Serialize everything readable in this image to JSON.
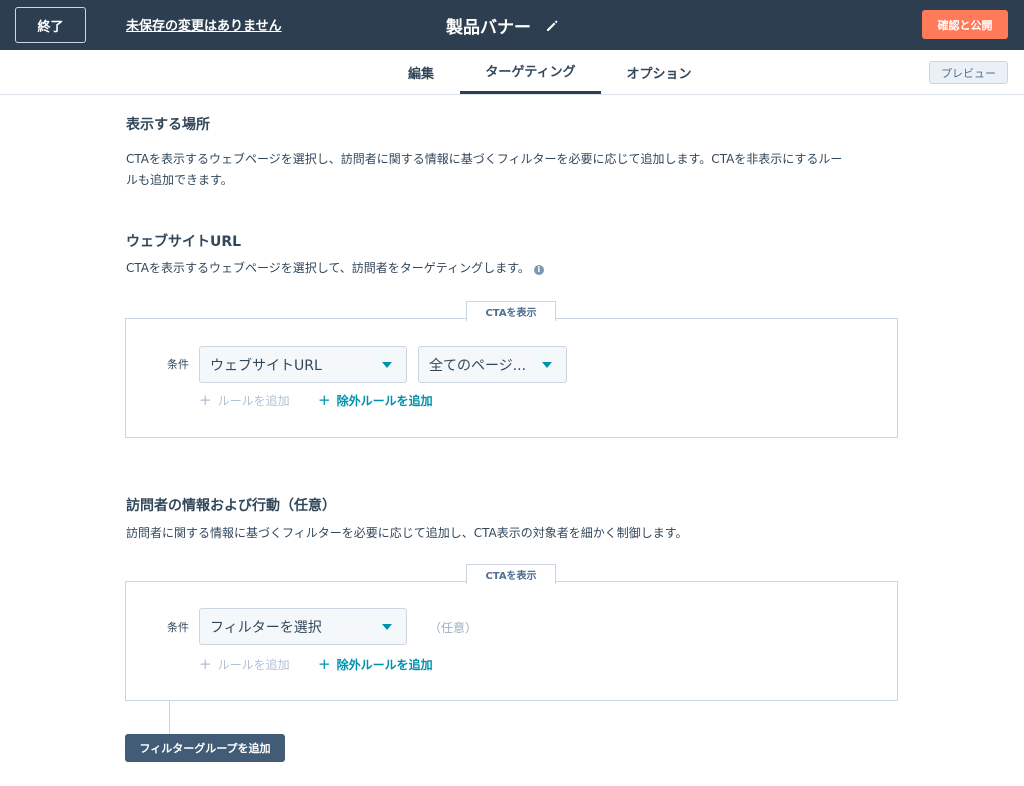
{
  "header": {
    "exit_label": "終了",
    "save_status": "未保存の変更はありません",
    "title": "製品バナー",
    "publish_label": "確認と公開"
  },
  "tabs": [
    {
      "label": "編集"
    },
    {
      "label": "ターゲティング",
      "active": true
    },
    {
      "label": "オプション"
    }
  ],
  "preview_label": "プレビュー",
  "where": {
    "heading": "表示する場所",
    "description_line1": "CTAを表示するウェブページを選択し、訪問者に関する情報に基づくフィルターを必要に応じて追加します。CTAを非表示にするルー",
    "description_line2": "ルも追加できます。"
  },
  "website": {
    "heading": "ウェブサイトURL",
    "description": "CTAを表示するウェブページを選択して、訪問者をターゲティングします。",
    "box_label": "CTAを表示",
    "condition_label": "条件",
    "select1": "ウェブサイトURL",
    "select2": "全てのページ...",
    "add_rule": "ルールを追加",
    "add_exclude": "除外ルールを追加"
  },
  "visitor": {
    "heading": "訪問者の情報および行動（任意）",
    "description": "訪問者に関する情報に基づくフィルターを必要に応じて追加し、CTA表示の対象者を細かく制御します。",
    "box_label": "CTAを表示",
    "condition_label": "条件",
    "select1": "フィルターを選択",
    "optional": "（任意）",
    "add_rule": "ルールを追加",
    "add_exclude": "除外ルールを追加"
  },
  "add_filter_group": "フィルターグループを追加",
  "colors": {
    "header_bg": "#2d3e50",
    "accent_orange": "#ff7a59",
    "link_teal": "#0091ae",
    "button_dark": "#425b76"
  },
  "icons": {
    "pencil": "pencil-icon",
    "info": "info-icon",
    "caret": "caret-down-icon",
    "plus": "plus-icon"
  }
}
